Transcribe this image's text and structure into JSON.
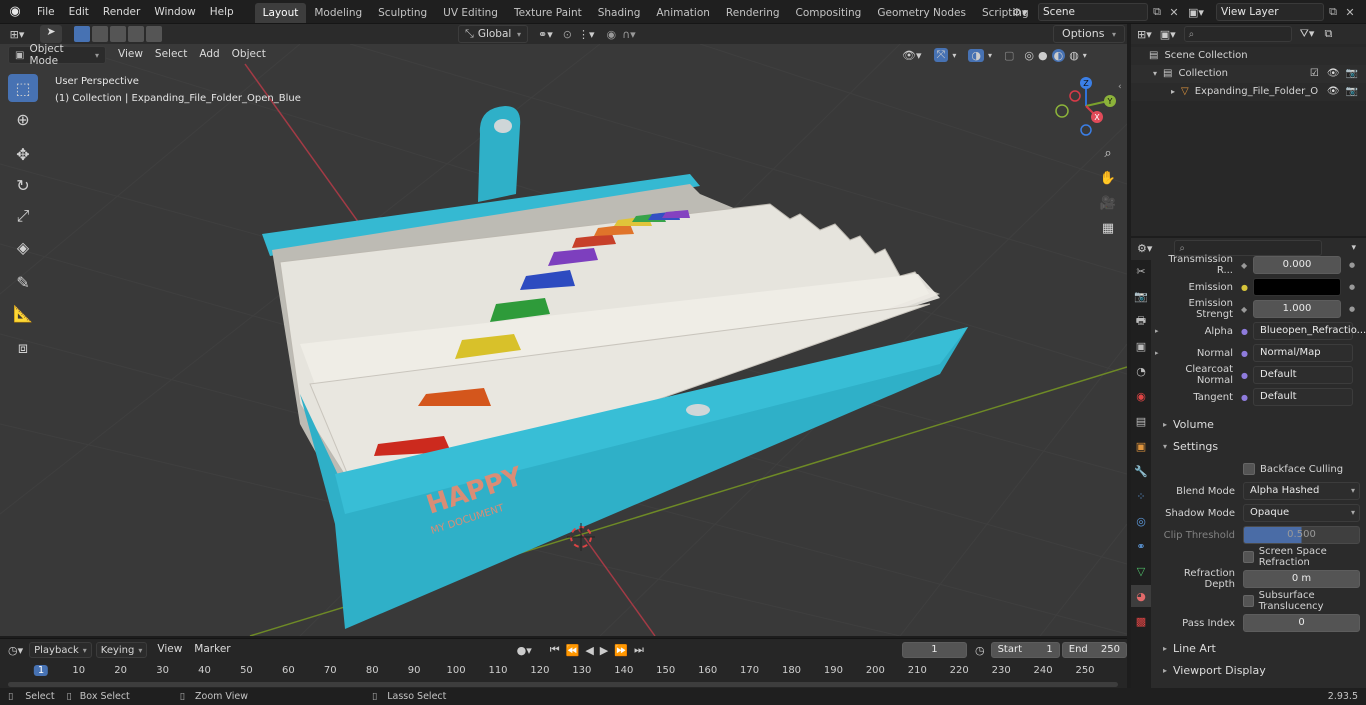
{
  "topbar": {
    "menus": [
      "File",
      "Edit",
      "Render",
      "Window",
      "Help"
    ],
    "workspaces": [
      "Layout",
      "Modeling",
      "Sculpting",
      "UV Editing",
      "Texture Paint",
      "Shading",
      "Animation",
      "Rendering",
      "Compositing",
      "Geometry Nodes",
      "Scripting"
    ],
    "active_workspace": "Layout",
    "scene": "Scene",
    "view_layer": "View Layer"
  },
  "viewport": {
    "mode": "Object Mode",
    "menus": [
      "View",
      "Select",
      "Add",
      "Object"
    ],
    "transform_orientation": "Global",
    "options_label": "Options",
    "perspective_label": "User Perspective",
    "collection_label": "(1) Collection | Expanding_File_Folder_Open_Blue",
    "model_text_1": "HAPPY",
    "model_text_2": "MY DOCUMENT",
    "gizmo_axes": [
      "Z",
      "Y",
      "X"
    ]
  },
  "outliner": {
    "scene_collection": "Scene Collection",
    "collection": "Collection",
    "object": "Expanding_File_Folder_O"
  },
  "properties": {
    "rows": [
      {
        "label": "Transmission R...",
        "value": "0.000"
      },
      {
        "label": "Emission",
        "value": ""
      },
      {
        "label": "Emission Strengt",
        "value": "1.000"
      },
      {
        "label": "Alpha",
        "value": "Blueopen_Refractio..."
      },
      {
        "label": "Normal",
        "value": "Normal/Map"
      },
      {
        "label": "Clearcoat Normal",
        "value": "Default"
      },
      {
        "label": "Tangent",
        "value": "Default"
      }
    ],
    "volume_label": "Volume",
    "settings_label": "Settings",
    "backface_culling": "Backface Culling",
    "blend_mode_label": "Blend Mode",
    "blend_mode": "Alpha Hashed",
    "shadow_mode_label": "Shadow Mode",
    "shadow_mode": "Opaque",
    "clip_threshold_label": "Clip Threshold",
    "clip_threshold": "0.500",
    "ssr_label": "Screen Space Refraction",
    "refraction_depth_label": "Refraction Depth",
    "refraction_depth": "0 m",
    "subsurface_label": "Subsurface Translucency",
    "pass_index_label": "Pass Index",
    "pass_index": "0",
    "line_art_label": "Line Art",
    "viewport_display_label": "Viewport Display"
  },
  "timeline": {
    "menus": [
      "Playback",
      "Keying",
      "View",
      "Marker"
    ],
    "current_frame": "1",
    "start_label": "Start",
    "start": "1",
    "end_label": "End",
    "end": "250",
    "ticks": [
      "1",
      "10",
      "20",
      "30",
      "40",
      "50",
      "60",
      "70",
      "80",
      "90",
      "100",
      "110",
      "120",
      "130",
      "140",
      "150",
      "160",
      "170",
      "180",
      "190",
      "200",
      "210",
      "220",
      "230",
      "240",
      "250"
    ]
  },
  "statusbar": {
    "select": "Select",
    "box_select": "Box Select",
    "zoom_view": "Zoom View",
    "lasso_select": "Lasso Select",
    "version": "2.93.5"
  },
  "colors": {
    "accent": "#4772b3",
    "folder_teal": "#2fb0c8",
    "viewport_bg": "#393939"
  }
}
